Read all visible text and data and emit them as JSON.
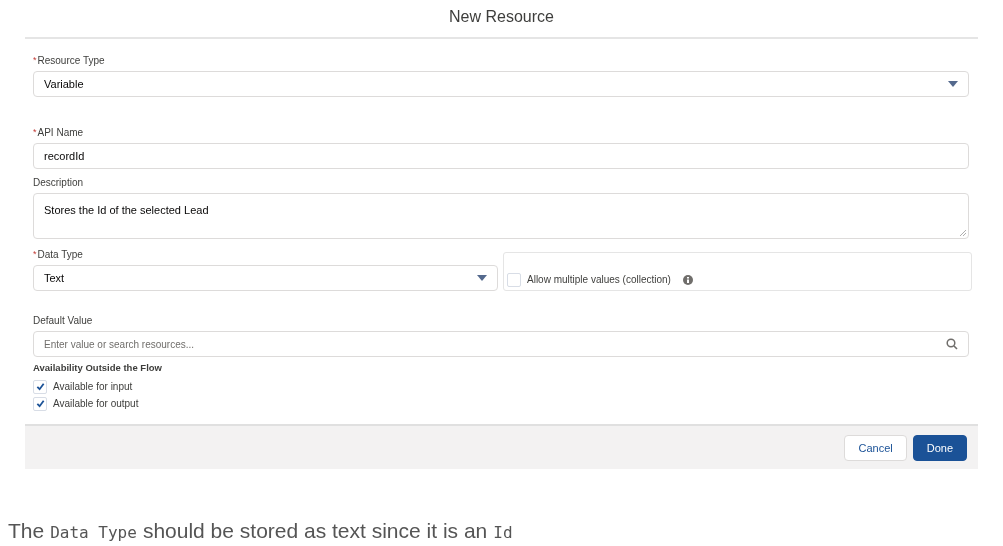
{
  "dialog": {
    "title": "New Resource"
  },
  "fields": [
    {
      "kind": "select",
      "label": "Resource Type",
      "required_mark": "*",
      "value": "Variable"
    },
    {
      "kind": "input",
      "label": "API Name",
      "required_mark": "*",
      "value": "recordId"
    },
    {
      "kind": "textarea",
      "label": "Description",
      "value": "Stores the Id of the selected Lead"
    },
    {
      "kind": "select_with_option",
      "label": "Data Type",
      "required_mark": "*",
      "value": "Text",
      "option": {
        "label": "Allow multiple values (collection)",
        "checked": false
      }
    },
    {
      "kind": "search",
      "label": "Default Value",
      "placeholder": "Enter value or search resources..."
    }
  ],
  "availability": {
    "heading": "Availability Outside the Flow",
    "options": [
      {
        "label": "Available for input",
        "checked": true
      },
      {
        "label": "Available for output",
        "checked": true
      }
    ]
  },
  "buttons": [
    {
      "label": "Cancel",
      "kind": "neutral"
    },
    {
      "label": "Done",
      "kind": "brand"
    }
  ],
  "caption": [
    {
      "kind": "text",
      "text": "The"
    },
    {
      "kind": "code",
      "text": "Data Type"
    },
    {
      "kind": "text",
      "text": "should be stored as text since it is an"
    },
    {
      "kind": "code",
      "text": "Id"
    }
  ]
}
